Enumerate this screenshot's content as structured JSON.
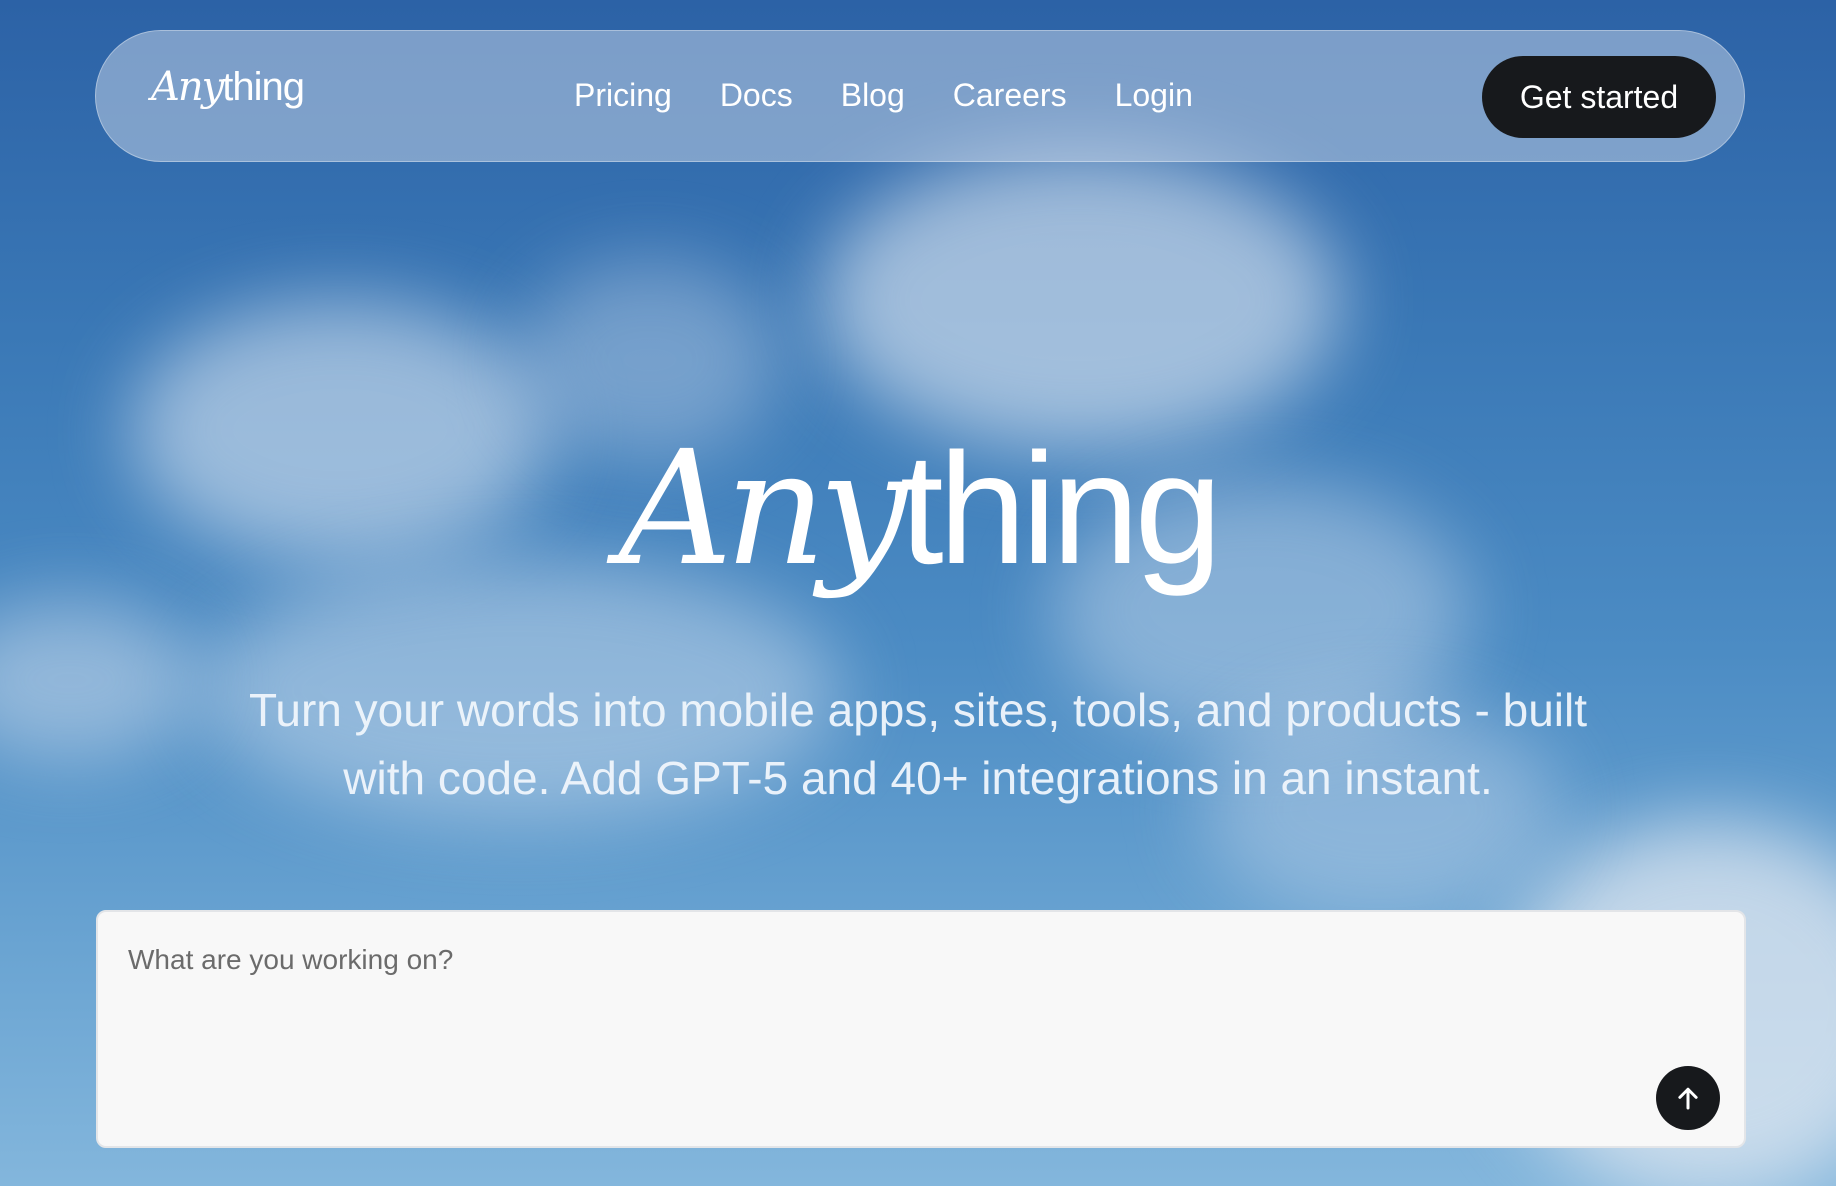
{
  "brand": {
    "logo_any": "Any",
    "logo_thing": "thing"
  },
  "nav": {
    "links": [
      {
        "label": "Pricing"
      },
      {
        "label": "Docs"
      },
      {
        "label": "Blog"
      },
      {
        "label": "Careers"
      },
      {
        "label": "Login"
      }
    ],
    "cta_label": "Get started"
  },
  "hero": {
    "title_any": "Any",
    "title_thing": "thing",
    "tagline_line1": "Turn your words into mobile apps, sites, tools, and products - built",
    "tagline_line2": "with code. Add GPT-5 and 40+ integrations in an instant."
  },
  "prompt": {
    "placeholder": "What are you working on?",
    "value": "",
    "send_icon": "arrow-up-icon"
  },
  "colors": {
    "cta_bg": "#17191c",
    "text_light": "#ffffff",
    "input_bg": "#f8f8f8"
  }
}
